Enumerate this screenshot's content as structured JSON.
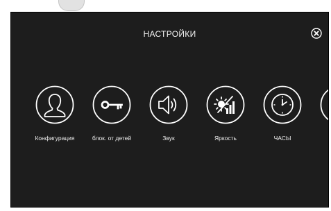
{
  "header": {
    "title": "НАСТРОЙКИ"
  },
  "icons": {
    "close": "close-icon"
  },
  "menu": {
    "items": [
      {
        "label": "Конфигурация",
        "icon": "user-icon"
      },
      {
        "label": "блок. от детей",
        "icon": "key-icon"
      },
      {
        "label": "Звук",
        "icon": "speaker-icon"
      },
      {
        "label": "Яркость",
        "icon": "brightness-icon"
      },
      {
        "label": "ЧАСЫ",
        "icon": "clock-icon"
      },
      {
        "label": "",
        "icon": "partial-next-icon"
      }
    ]
  },
  "colors": {
    "screen_bg": "#1d1d1d",
    "foreground": "#ffffff"
  }
}
